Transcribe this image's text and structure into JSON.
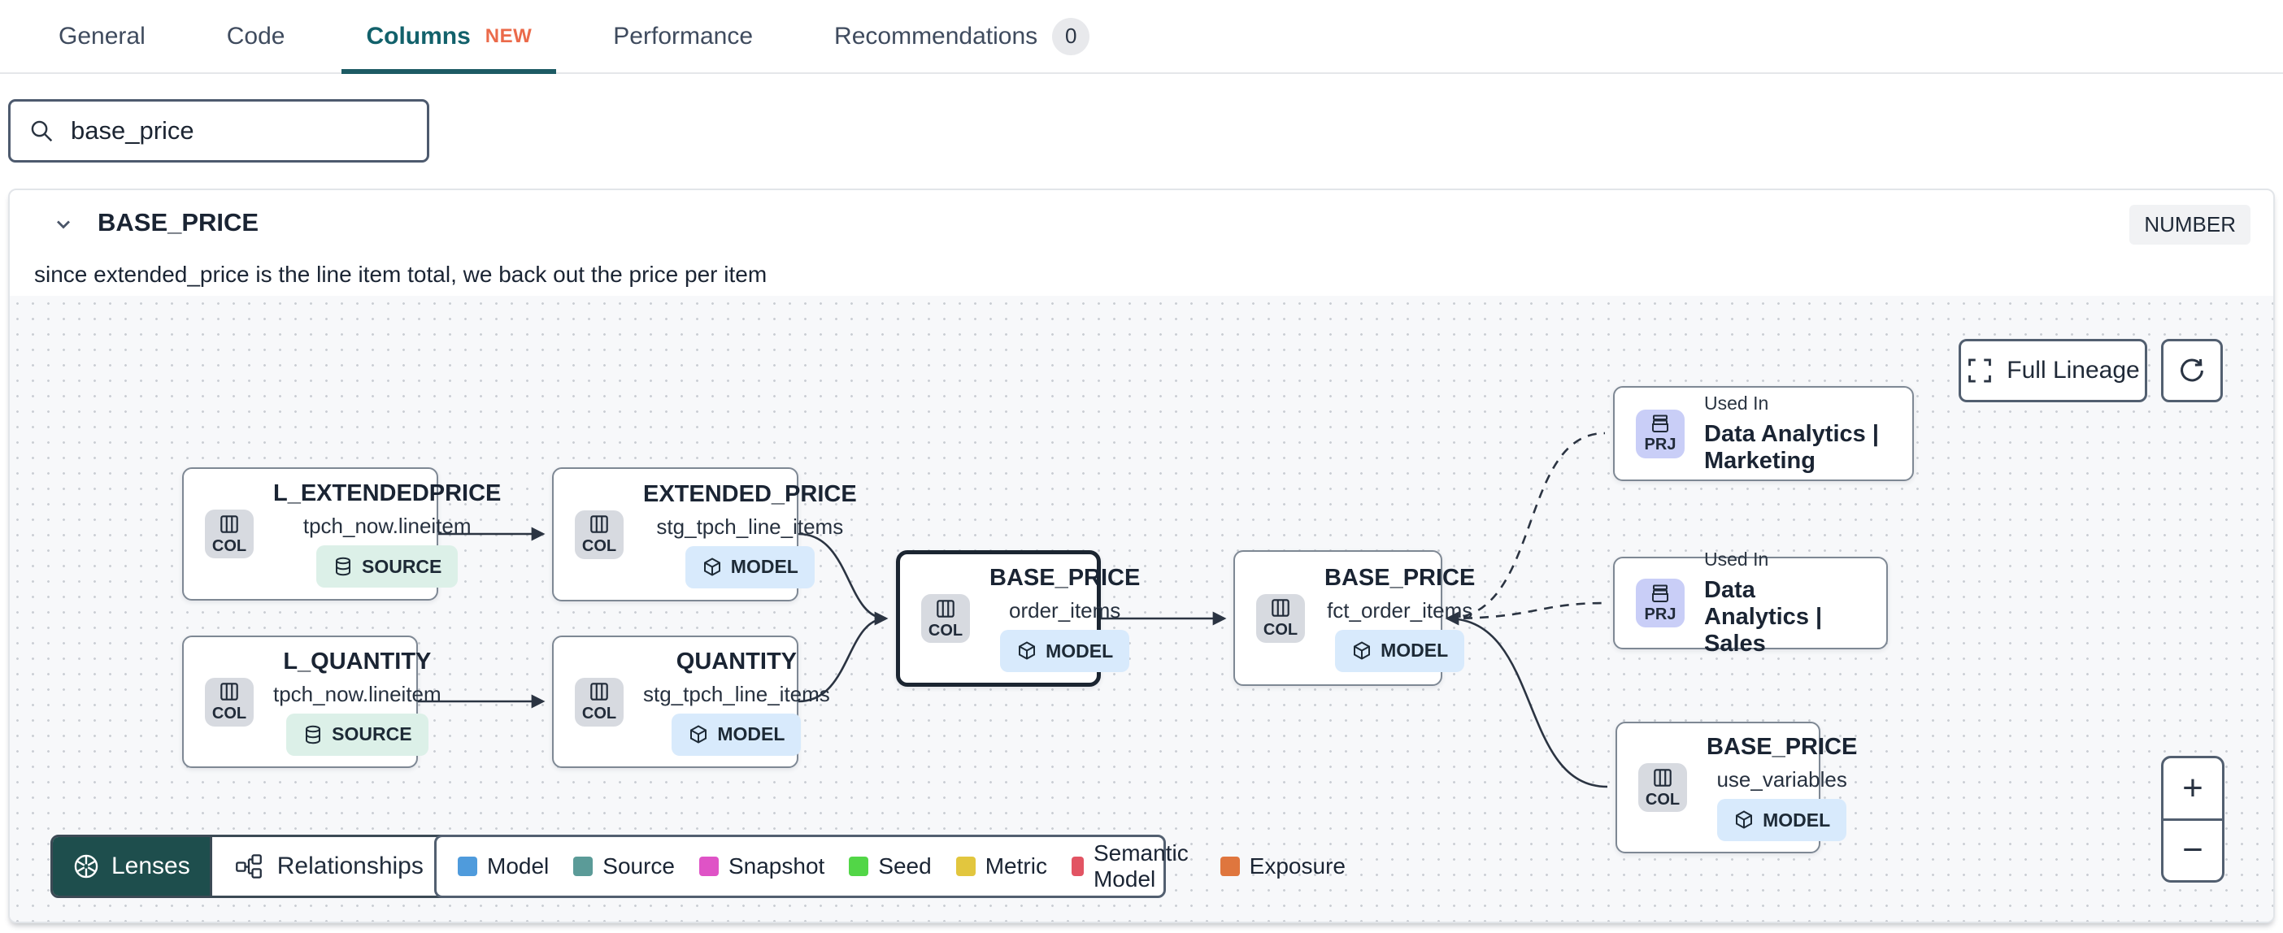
{
  "tabs": {
    "items": [
      {
        "label": "General"
      },
      {
        "label": "Code"
      },
      {
        "label": "Columns",
        "badge": "NEW"
      },
      {
        "label": "Performance"
      },
      {
        "label": "Recommendations",
        "count": "0"
      }
    ]
  },
  "search": {
    "value": "base_price"
  },
  "column_panel": {
    "name": "BASE_PRICE",
    "type": "NUMBER",
    "description": "since extended_price is the line item total, we back out the price per item"
  },
  "lineage": {
    "full_lineage_label": "Full Lineage",
    "zoom_in": "+",
    "zoom_out": "−",
    "lenses_label": "Lenses",
    "relationships_label": "Relationships",
    "nodes": [
      {
        "kind": "COL",
        "title": "L_EXTENDEDPRICE",
        "subtitle": "tpch_now.lineitem",
        "badge": "SOURCE"
      },
      {
        "kind": "COL",
        "title": "EXTENDED_PRICE",
        "subtitle": "stg_tpch_line_items",
        "badge": "MODEL"
      },
      {
        "kind": "COL",
        "title": "L_QUANTITY",
        "subtitle": "tpch_now.lineitem",
        "badge": "SOURCE"
      },
      {
        "kind": "COL",
        "title": "QUANTITY",
        "subtitle": "stg_tpch_line_items",
        "badge": "MODEL"
      },
      {
        "kind": "COL",
        "title": "BASE_PRICE",
        "subtitle": "order_items",
        "badge": "MODEL"
      },
      {
        "kind": "COL",
        "title": "BASE_PRICE",
        "subtitle": "fct_order_items",
        "badge": "MODEL"
      },
      {
        "kind": "PRJ",
        "eyebrow": "Used In",
        "title": "Data Analytics | Marketing"
      },
      {
        "kind": "PRJ",
        "eyebrow": "Used In",
        "title": "Data Analytics | Sales"
      },
      {
        "kind": "COL",
        "title": "BASE_PRICE",
        "subtitle": "use_variables",
        "badge": "MODEL"
      }
    ],
    "legend": [
      {
        "label": "Model",
        "color": "#4f9bdc"
      },
      {
        "label": "Source",
        "color": "#5b9b98"
      },
      {
        "label": "Snapshot",
        "color": "#df53c6"
      },
      {
        "label": "Seed",
        "color": "#52d647"
      },
      {
        "label": "Metric",
        "color": "#e2c63e"
      },
      {
        "label": "Semantic Model",
        "color": "#e25463"
      },
      {
        "label": "Exposure",
        "color": "#df763e"
      }
    ],
    "colors": {
      "accent_teal": "#12616b",
      "new_badge": "#eb6a4a"
    }
  }
}
